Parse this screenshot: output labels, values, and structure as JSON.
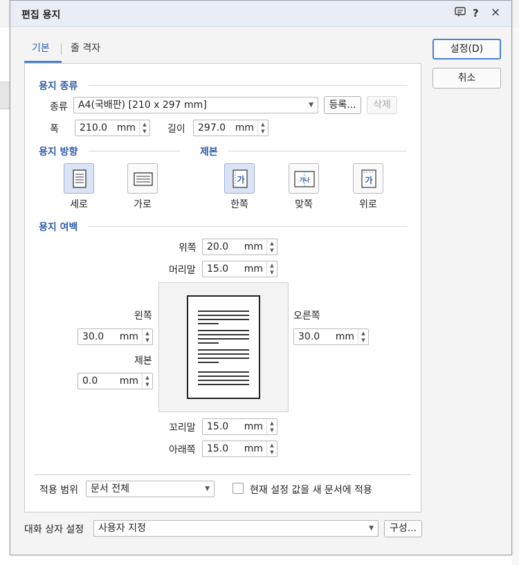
{
  "dialog": {
    "title": "편집 용지",
    "title_icons": [
      "comment-icon",
      "help-icon",
      "close-icon"
    ],
    "help_glyph": "?",
    "close_glyph": "×"
  },
  "tabs": [
    {
      "label": "기본",
      "active": true
    },
    {
      "label": "줄 격자",
      "active": false
    }
  ],
  "buttons": {
    "ok": "설정(D)",
    "cancel": "취소",
    "register": "등록...",
    "delete": "삭제",
    "configure": "구성..."
  },
  "paper_type": {
    "section": "용지 종류",
    "type_label": "종류",
    "type_value": "A4(국배판)  [210 x 297 mm]",
    "width_label": "폭",
    "width_value": "210.0",
    "height_label": "길이",
    "height_value": "297.0",
    "unit": "mm"
  },
  "orientation": {
    "section": "용지 방향",
    "options": [
      {
        "label": "세로",
        "selected": true
      },
      {
        "label": "가로",
        "selected": false
      }
    ]
  },
  "binding": {
    "section": "제본",
    "options": [
      {
        "label": "한쪽",
        "selected": true,
        "glyph": "가"
      },
      {
        "label": "맞쪽",
        "selected": false,
        "glyph": "가나"
      },
      {
        "label": "위로",
        "selected": false,
        "glyph": "가"
      }
    ]
  },
  "margins": {
    "section": "용지 여백",
    "unit": "mm",
    "top": {
      "label": "위쪽",
      "value": "20.0"
    },
    "header": {
      "label": "머리말",
      "value": "15.0"
    },
    "left": {
      "label": "왼쪽",
      "value": "30.0"
    },
    "right": {
      "label": "오른쪽",
      "value": "30.0"
    },
    "gutter": {
      "label": "제본",
      "value": "0.0"
    },
    "footer": {
      "label": "꼬리말",
      "value": "15.0"
    },
    "bottom": {
      "label": "아래쪽",
      "value": "15.0"
    }
  },
  "apply": {
    "scope_label": "적용 범위",
    "scope_value": "문서 전체",
    "new_doc_checkbox": "현재 설정 값을 새 문서에 적용",
    "new_doc_checked": false
  },
  "dialog_settings": {
    "label": "대화 상자 설정",
    "value": "사용자 지정"
  },
  "colors": {
    "accent": "#4a7fd0",
    "section_text": "#2f5ea8",
    "selected_bg": "#dbe4f6"
  }
}
